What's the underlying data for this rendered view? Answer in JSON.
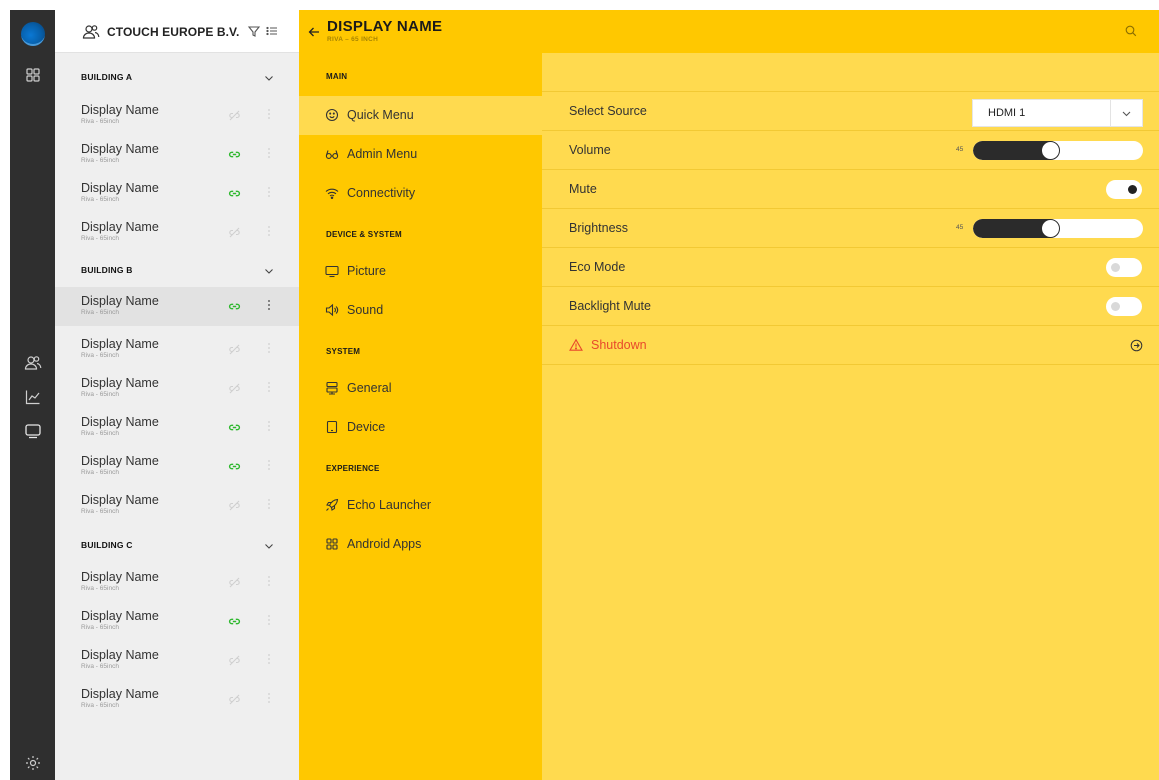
{
  "organization": {
    "name": "CTOUCH EUROPE B.V."
  },
  "header": {
    "title": "DISPLAY NAME",
    "subtitle": "RIVA – 65 INCH"
  },
  "rail": {
    "icons": [
      "app-logo",
      "grid-icon",
      "users-icon",
      "chart-icon",
      "monitor-icon",
      "settings-icon"
    ]
  },
  "buildings": [
    {
      "name": "BUILDING A",
      "devices": [
        {
          "name": "Display Name",
          "model": "Riva - 65inch",
          "connected": false
        },
        {
          "name": "Display Name",
          "model": "Riva - 65inch",
          "connected": true
        },
        {
          "name": "Display Name",
          "model": "Riva - 65inch",
          "connected": true
        },
        {
          "name": "Display Name",
          "model": "Riva - 65inch",
          "connected": false
        }
      ]
    },
    {
      "name": "BUILDING B",
      "devices": [
        {
          "name": "Display Name",
          "model": "Riva - 65inch",
          "connected": true,
          "selected": true
        },
        {
          "name": "Display Name",
          "model": "Riva - 65inch",
          "connected": false
        },
        {
          "name": "Display Name",
          "model": "Riva - 65inch",
          "connected": false
        },
        {
          "name": "Display Name",
          "model": "Riva - 65inch",
          "connected": true
        },
        {
          "name": "Display Name",
          "model": "Riva - 65inch",
          "connected": true
        },
        {
          "name": "Display Name",
          "model": "Riva - 65inch",
          "connected": false
        }
      ]
    },
    {
      "name": "BUILDING C",
      "devices": [
        {
          "name": "Display Name",
          "model": "Riva - 65inch",
          "connected": false
        },
        {
          "name": "Display Name",
          "model": "Riva - 65inch",
          "connected": true
        },
        {
          "name": "Display Name",
          "model": "Riva - 65inch",
          "connected": false
        },
        {
          "name": "Display Name",
          "model": "Riva - 65inch",
          "connected": false
        }
      ]
    }
  ],
  "menu": {
    "sections": [
      {
        "title": "MAIN",
        "items": [
          {
            "label": "Quick Menu",
            "icon": "smiley-icon",
            "active": true
          },
          {
            "label": "Admin Menu",
            "icon": "glasses-icon"
          },
          {
            "label": "Connectivity",
            "icon": "wifi-icon"
          }
        ]
      },
      {
        "title": "DEVICE & SYSTEM",
        "items": [
          {
            "label": "Picture",
            "icon": "monitor-icon"
          },
          {
            "label": "Sound",
            "icon": "speaker-icon"
          }
        ]
      },
      {
        "title": "SYSTEM",
        "items": [
          {
            "label": "General",
            "icon": "server-icon"
          },
          {
            "label": "Device",
            "icon": "tablet-icon"
          }
        ]
      },
      {
        "title": "EXPERIENCE",
        "items": [
          {
            "label": "Echo Launcher",
            "icon": "rocket-icon"
          },
          {
            "label": "Android Apps",
            "icon": "apps-grid-icon"
          }
        ]
      }
    ]
  },
  "settings": {
    "select_source": {
      "label": "Select Source",
      "value": "HDMI 1"
    },
    "volume": {
      "label": "Volume",
      "value": 45
    },
    "mute": {
      "label": "Mute",
      "on": true
    },
    "brightness": {
      "label": "Brightness",
      "value": 45
    },
    "eco_mode": {
      "label": "Eco Mode",
      "on": false
    },
    "backlight_mute": {
      "label": "Backlight Mute",
      "on": false
    },
    "shutdown": {
      "label": "Shutdown"
    }
  },
  "colors": {
    "accent": "#ffc800",
    "panel": "#ffda4f",
    "connected": "#2eb82e",
    "disconnected": "#c8c8c8",
    "warning": "#e8492b",
    "rail": "#2f2f2f"
  }
}
